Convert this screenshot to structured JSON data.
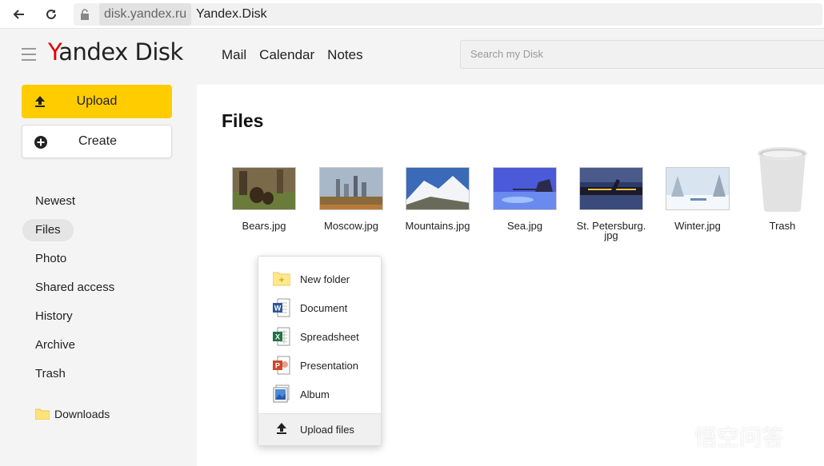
{
  "browser": {
    "domain": "disk.yandex.ru",
    "title": "Yandex.Disk"
  },
  "header": {
    "logo_y": "Y",
    "logo_rest": "andex Disk",
    "nav": [
      "Mail",
      "Calendar",
      "Notes"
    ],
    "search_placeholder": "Search my Disk"
  },
  "sidebar": {
    "upload_label": "Upload",
    "create_label": "Create",
    "items": [
      {
        "label": "Newest"
      },
      {
        "label": "Files",
        "active": true
      },
      {
        "label": "Photo"
      },
      {
        "label": "Shared access"
      },
      {
        "label": "History"
      },
      {
        "label": "Archive"
      },
      {
        "label": "Trash"
      }
    ],
    "downloads_label": "Downloads"
  },
  "main": {
    "title": "Files",
    "files": [
      {
        "name": "Bears.jpg"
      },
      {
        "name": "Moscow.jpg"
      },
      {
        "name": "Mountains.jpg"
      },
      {
        "name": "Sea.jpg"
      },
      {
        "name": "St. Petersburg.",
        "name2": "jpg"
      },
      {
        "name": "Winter.jpg"
      }
    ],
    "trash_label": "Trash"
  },
  "menu": {
    "items": [
      {
        "label": "New folder",
        "icon": "new-folder-icon"
      },
      {
        "label": "Document",
        "icon": "word-document-icon"
      },
      {
        "label": "Spreadsheet",
        "icon": "excel-spreadsheet-icon"
      },
      {
        "label": "Presentation",
        "icon": "powerpoint-presentation-icon"
      },
      {
        "label": "Album",
        "icon": "album-icon"
      }
    ],
    "upload_label": "Upload files"
  },
  "watermark": "悟空问答",
  "colors": {
    "accent_yellow": "#ffcc00",
    "logo_red": "#e30000"
  }
}
